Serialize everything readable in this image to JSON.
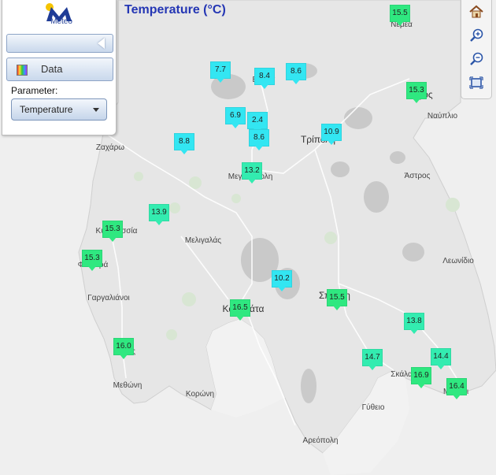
{
  "header": {
    "title": "Temperature (°C)"
  },
  "panel": {
    "logo_text": "Meteo",
    "data_label": "Data",
    "parameter_label": "Parameter:",
    "parameter_value": "Temperature"
  },
  "tools": [
    "home-icon",
    "zoom-in-icon",
    "zoom-out-icon",
    "zoom-extent-icon"
  ],
  "colors": {
    "cold": "#33e6f2",
    "mild": "#33ecb0",
    "warm": "#2fe880",
    "sea": "#f3f3f3",
    "land": "#e7e7e7"
  },
  "places": [
    {
      "name": "Νεμέα",
      "big": false
    },
    {
      "name": "Βυτίνα",
      "big": false
    },
    {
      "name": "Άργος",
      "big": true
    },
    {
      "name": "Ναύπλιο",
      "big": false
    },
    {
      "name": "Ζαχάρω",
      "big": false
    },
    {
      "name": "Τρίπολη",
      "big": true
    },
    {
      "name": "Μεγαλόπολη",
      "big": false
    },
    {
      "name": "Άστρος",
      "big": false
    },
    {
      "name": "Κυπαρισσία",
      "big": false
    },
    {
      "name": "Μελιγαλάς",
      "big": false
    },
    {
      "name": "Φιλιατρά",
      "big": false
    },
    {
      "name": "Λεωνίδιο",
      "big": false
    },
    {
      "name": "Γαργαλιάνοι",
      "big": false
    },
    {
      "name": "Καλαμάτα",
      "big": true
    },
    {
      "name": "Σπάρτη",
      "big": true
    },
    {
      "name": "Πύλος",
      "big": false
    },
    {
      "name": "Σκάλα",
      "big": false
    },
    {
      "name": "Μεθώνη",
      "big": false
    },
    {
      "name": "Κορώνη",
      "big": false
    },
    {
      "name": "Μολάοι",
      "big": false
    },
    {
      "name": "Γύθειο",
      "big": false
    },
    {
      "name": "Αρεόπολη",
      "big": false
    }
  ],
  "stations": [
    {
      "value": "15.5",
      "temp": 15.5
    },
    {
      "value": "7.7",
      "temp": 7.7
    },
    {
      "value": "8.4",
      "temp": 8.4
    },
    {
      "value": "8.6",
      "temp": 8.6
    },
    {
      "value": "15.3",
      "temp": 15.3
    },
    {
      "value": "6.9",
      "temp": 6.9
    },
    {
      "value": "2.4",
      "temp": 2.4
    },
    {
      "value": "8.6",
      "temp": 8.6
    },
    {
      "value": "8.8",
      "temp": 8.8
    },
    {
      "value": "10.9",
      "temp": 10.9
    },
    {
      "value": "13.2",
      "temp": 13.2
    },
    {
      "value": "13.9",
      "temp": 13.9
    },
    {
      "value": "15.3",
      "temp": 15.3
    },
    {
      "value": "15.3",
      "temp": 15.3
    },
    {
      "value": "10.2",
      "temp": 10.2
    },
    {
      "value": "16.5",
      "temp": 16.5
    },
    {
      "value": "15.5",
      "temp": 15.5
    },
    {
      "value": "13.8",
      "temp": 13.8
    },
    {
      "value": "16.0",
      "temp": 16.0
    },
    {
      "value": "14.7",
      "temp": 14.7
    },
    {
      "value": "14.4",
      "temp": 14.4
    },
    {
      "value": "16.9",
      "temp": 16.9
    },
    {
      "value": "16.4",
      "temp": 16.4
    }
  ]
}
